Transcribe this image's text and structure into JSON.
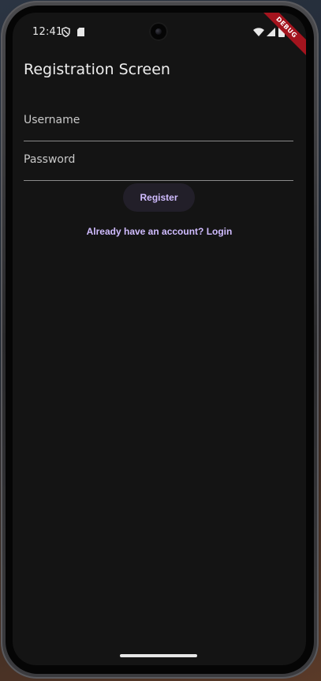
{
  "status_bar": {
    "time": "12:41",
    "left_icons": [
      "shield-icon",
      "sd-card-icon"
    ],
    "right_icons": [
      "wifi-icon",
      "signal-icon",
      "battery-icon"
    ]
  },
  "debug_banner": "DEBUG",
  "app_bar": {
    "title": "Registration Screen"
  },
  "form": {
    "username_label": "Username",
    "password_label": "Password",
    "register_label": "Register",
    "login_link": "Already have an account? Login"
  },
  "colors": {
    "background": "#141414",
    "accent": "#d0bcff",
    "button_bg": "#221f29",
    "divider": "#8a8a8a",
    "debug": "#a3141e"
  }
}
